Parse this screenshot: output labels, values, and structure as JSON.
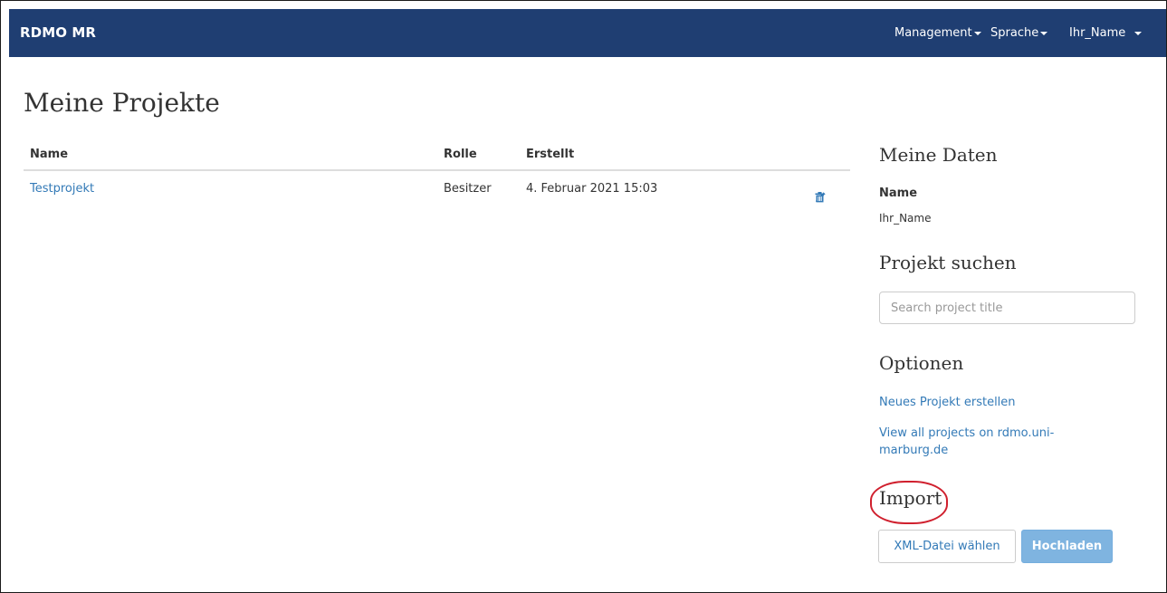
{
  "navbar": {
    "brand": "RDMO MR",
    "management_label": "Management",
    "language_label": "Sprache",
    "user_label": "Ihr_Name"
  },
  "main": {
    "title": "Meine Projekte",
    "table": {
      "headers": {
        "name": "Name",
        "role": "Rolle",
        "created": "Erstellt"
      },
      "rows": [
        {
          "name": "Testprojekt",
          "role": "Besitzer",
          "created": "4. Februar 2021 15:03"
        }
      ]
    }
  },
  "sidebar": {
    "my_data": {
      "heading": "Meine Daten",
      "name_label": "Name",
      "name_value": "Ihr_Name"
    },
    "search": {
      "heading": "Projekt suchen",
      "placeholder": "Search project title"
    },
    "options": {
      "heading": "Optionen",
      "new_project": "Neues Projekt erstellen",
      "view_all": "View all projects on rdmo.uni-marburg.de"
    },
    "import": {
      "heading": "Import",
      "file_button": "XML-Datei wählen",
      "upload_button": "Hochladen"
    }
  },
  "colors": {
    "navbar_bg": "#1f3e72",
    "link": "#337ab7",
    "upload_button_bg": "#7fb4e0",
    "highlight_circle": "#d0202e"
  },
  "icons": [
    "pencil-icon",
    "trash-icon",
    "caret-down-icon"
  ]
}
